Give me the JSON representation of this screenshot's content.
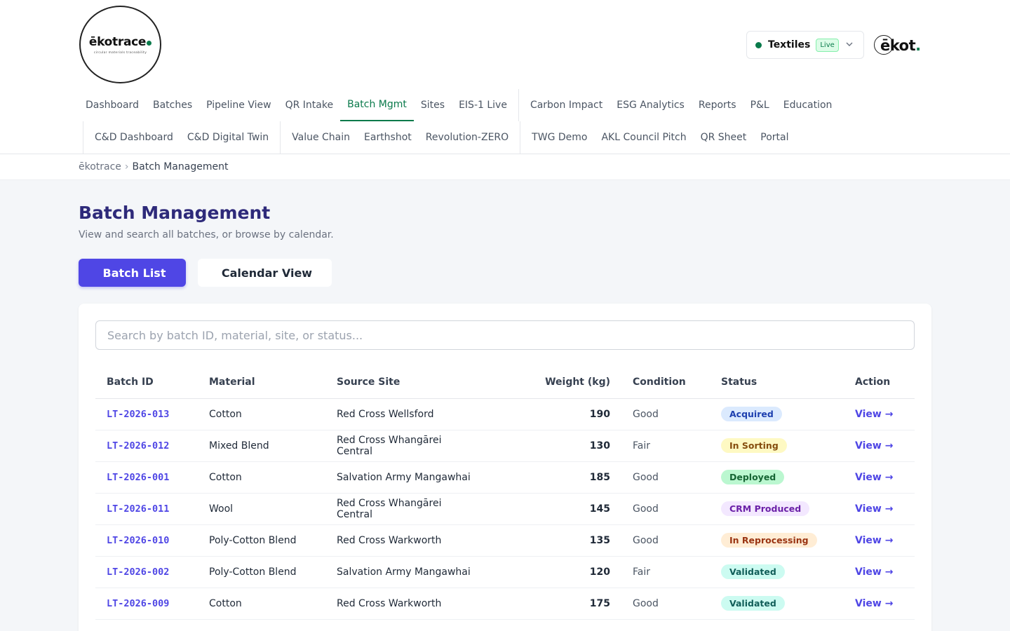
{
  "brand": {
    "logo_word": "ēkotrace",
    "logo_tagline": "circular materials traceability",
    "mark_text": "ēkot",
    "mark_dot": "."
  },
  "sector": {
    "label": "Textiles",
    "badge": "Live",
    "status_color": "#0a7a4b"
  },
  "nav": {
    "row1": [
      {
        "label": "Dashboard",
        "active": false
      },
      {
        "label": "Batches",
        "active": false
      },
      {
        "label": "Pipeline View",
        "active": false
      },
      {
        "label": "QR Intake",
        "active": false
      },
      {
        "label": "Batch Mgmt",
        "active": true
      },
      {
        "label": "Sites",
        "active": false
      },
      {
        "label": "EIS-1 Live",
        "active": false
      },
      {
        "sep": true
      },
      {
        "label": "Carbon Impact",
        "active": false
      },
      {
        "label": "ESG Analytics",
        "active": false
      },
      {
        "label": "Reports",
        "active": false
      },
      {
        "label": "P&L",
        "active": false
      },
      {
        "label": "Education",
        "active": false
      }
    ],
    "row2": [
      {
        "sep": true
      },
      {
        "label": "C&D Dashboard",
        "active": false
      },
      {
        "label": "C&D Digital Twin",
        "active": false
      },
      {
        "sep": true
      },
      {
        "label": "Value Chain",
        "active": false
      },
      {
        "label": "Earthshot",
        "active": false
      },
      {
        "label": "Revolution-ZERO",
        "active": false
      },
      {
        "sep": true
      },
      {
        "label": "TWG Demo",
        "active": false
      },
      {
        "label": "AKL Council Pitch",
        "active": false
      },
      {
        "label": "QR Sheet",
        "active": false
      },
      {
        "label": "Portal",
        "active": false
      }
    ]
  },
  "breadcrumb": {
    "home": "ēkotrace",
    "separator": "›",
    "current": "Batch Management"
  },
  "page": {
    "title": "Batch Management",
    "subtitle": "View and search all batches, or browse by calendar.",
    "views": {
      "list_icon": "",
      "list_label": "Batch List",
      "calendar_icon": "",
      "calendar_label": "Calendar View"
    }
  },
  "search": {
    "placeholder": "Search by batch ID, material, site, or status...",
    "value": ""
  },
  "table": {
    "headers": {
      "batch_id": "Batch ID",
      "material": "Material",
      "source_site": "Source Site",
      "weight": "Weight (kg)",
      "condition": "Condition",
      "status": "Status",
      "action": "Action"
    },
    "action_label": "View →",
    "rows": [
      {
        "id": "LT-2026-013",
        "material": "Cotton",
        "site": "Red Cross Wellsford",
        "weight": "190",
        "condition": "Good",
        "status": "Acquired",
        "status_bg": "#dbeafe",
        "status_fg": "#1e40af"
      },
      {
        "id": "LT-2026-012",
        "material": "Mixed Blend",
        "site": "Red Cross Whangārei Central",
        "weight": "130",
        "condition": "Fair",
        "status": "In Sorting",
        "status_bg": "#fef9c3",
        "status_fg": "#854d0e"
      },
      {
        "id": "LT-2026-001",
        "material": "Cotton",
        "site": "Salvation Army Mangawhai",
        "weight": "185",
        "condition": "Good",
        "status": "Deployed",
        "status_bg": "#bbf7d0",
        "status_fg": "#166534"
      },
      {
        "id": "LT-2026-011",
        "material": "Wool",
        "site": "Red Cross Whangārei Central",
        "weight": "145",
        "condition": "Good",
        "status": "CRM Produced",
        "status_bg": "#f3e8ff",
        "status_fg": "#6b21a8"
      },
      {
        "id": "LT-2026-010",
        "material": "Poly-Cotton Blend",
        "site": "Red Cross Warkworth",
        "weight": "135",
        "condition": "Good",
        "status": "In Reprocessing",
        "status_bg": "#ffedd5",
        "status_fg": "#9a3412"
      },
      {
        "id": "LT-2026-002",
        "material": "Poly-Cotton Blend",
        "site": "Salvation Army Mangawhai",
        "weight": "120",
        "condition": "Fair",
        "status": "Validated",
        "status_bg": "#ccfbf1",
        "status_fg": "#115e59"
      },
      {
        "id": "LT-2026-009",
        "material": "Cotton",
        "site": "Red Cross Warkworth",
        "weight": "175",
        "condition": "Good",
        "status": "Validated",
        "status_bg": "#ccfbf1",
        "status_fg": "#115e59"
      }
    ]
  }
}
